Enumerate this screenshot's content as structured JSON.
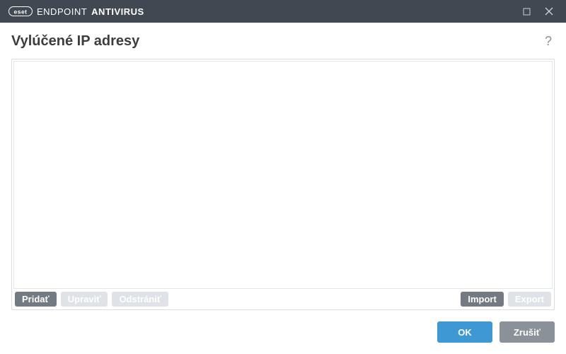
{
  "titlebar": {
    "brand_prefix": "ENDPOINT",
    "brand_suffix": "ANTIVIRUS",
    "logo_text": "eset"
  },
  "page": {
    "title": "Vylúčené IP adresy",
    "help_symbol": "?"
  },
  "actions": {
    "add": "Pridať",
    "edit": "Upraviť",
    "remove": "Odstrániť",
    "import": "Import",
    "export": "Export"
  },
  "footer": {
    "ok": "OK",
    "cancel": "Zrušiť"
  }
}
